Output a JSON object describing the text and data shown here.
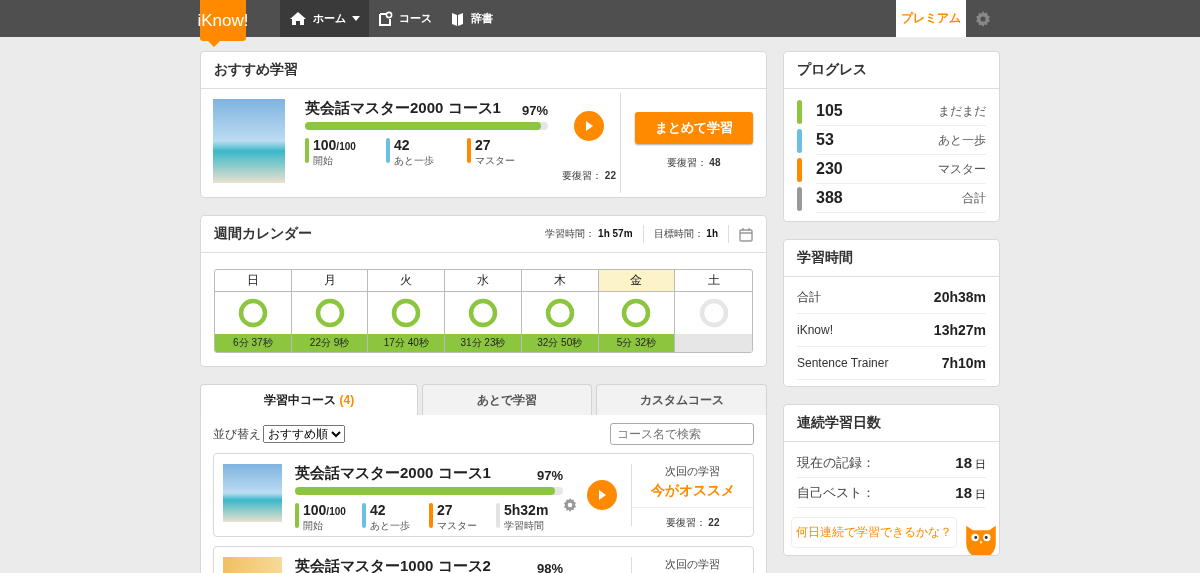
{
  "nav": {
    "logo": "iKnow!",
    "items": [
      {
        "label": "ホーム",
        "dropdown": true,
        "selected": true
      },
      {
        "label": "コース",
        "dropdown": false,
        "selected": false
      },
      {
        "label": "辞書",
        "dropdown": false,
        "selected": false
      }
    ],
    "premium": "プレミアム"
  },
  "recommended": {
    "title": "おすすめ学習",
    "course": {
      "title": "英会話マスター2000 コース1",
      "percent": "97%",
      "level": 0.97,
      "stats": [
        {
          "value": "100",
          "sub": "/100",
          "label": "開始",
          "color": "#8cc63f"
        },
        {
          "value": "42",
          "label": "あと一歩",
          "color": "#6bbfe6"
        },
        {
          "value": "27",
          "label": "マスター",
          "color": "#ff8a00"
        }
      ],
      "review_label": "要復習：",
      "review_count": "22"
    },
    "bulk_button": "まとめて学習",
    "bulk_review_label": "要復習：",
    "bulk_review_count": "48"
  },
  "calendar": {
    "title": "週間カレンダー",
    "study_label": "学習時間：",
    "study_time": "1h 57m",
    "goal_label": "目標時間：",
    "goal_time": "1h",
    "days": [
      {
        "day": "日",
        "time": "6分 37秒",
        "done": true,
        "today": false
      },
      {
        "day": "月",
        "time": "22分 9秒",
        "done": true,
        "today": false
      },
      {
        "day": "火",
        "time": "17分 40秒",
        "done": true,
        "today": false
      },
      {
        "day": "水",
        "time": "31分 23秒",
        "done": true,
        "today": false
      },
      {
        "day": "木",
        "time": "32分 50秒",
        "done": true,
        "today": false
      },
      {
        "day": "金",
        "time": "5分 32秒",
        "done": true,
        "today": true
      },
      {
        "day": "土",
        "done": false,
        "today": false
      }
    ]
  },
  "course_tabs": [
    {
      "label": "学習中コース",
      "count": "(4)",
      "selected": true
    },
    {
      "label": "あとで学習",
      "selected": false
    },
    {
      "label": "カスタムコース",
      "selected": false
    }
  ],
  "sort": {
    "label": "並び替え",
    "value": "おすすめ順"
  },
  "search": {
    "placeholder": "コース名で検索"
  },
  "courses": [
    {
      "title": "英会話マスター2000 コース1",
      "percent": "97%",
      "level": 0.97,
      "stats": [
        {
          "value": "100",
          "sub": "/100",
          "label": "開始",
          "color": "#8cc63f"
        },
        {
          "value": "42",
          "label": "あと一歩",
          "color": "#6bbfe6"
        },
        {
          "value": "27",
          "label": "マスター",
          "color": "#ff8a00"
        },
        {
          "value": "5h32m",
          "label": "学習時間",
          "color": "#e3e3e3"
        }
      ],
      "next_label": "次回の学習",
      "next": "今がオススメ",
      "review_label": "要復習：",
      "review_count": "22"
    },
    {
      "title": "英会話マスター1000 コース2",
      "percent": "98%",
      "next_label": "次回の学習"
    }
  ],
  "progress": {
    "title": "プログレス",
    "rows": [
      {
        "count": "105",
        "label": "まだまだ",
        "color": "#8cc63f"
      },
      {
        "count": "53",
        "label": "あと一歩",
        "color": "#6bbfe6"
      },
      {
        "count": "230",
        "label": "マスター",
        "color": "#ff8a00"
      },
      {
        "count": "388",
        "label": "合計",
        "color": "#999999"
      }
    ]
  },
  "study_time": {
    "title": "学習時間",
    "rows": [
      {
        "label": "合計",
        "value": "20h38m"
      },
      {
        "label": "iKnow!",
        "value": "13h27m"
      },
      {
        "label": "Sentence Trainer",
        "value": "7h10m"
      }
    ]
  },
  "streak": {
    "title": "連続学習日数",
    "rows": [
      {
        "label": "現在の記録：",
        "value": "18",
        "unit": "日"
      },
      {
        "label": "自己ベスト：",
        "value": "18",
        "unit": "日"
      }
    ],
    "bubble": "何日連続で学習できるかな？"
  }
}
